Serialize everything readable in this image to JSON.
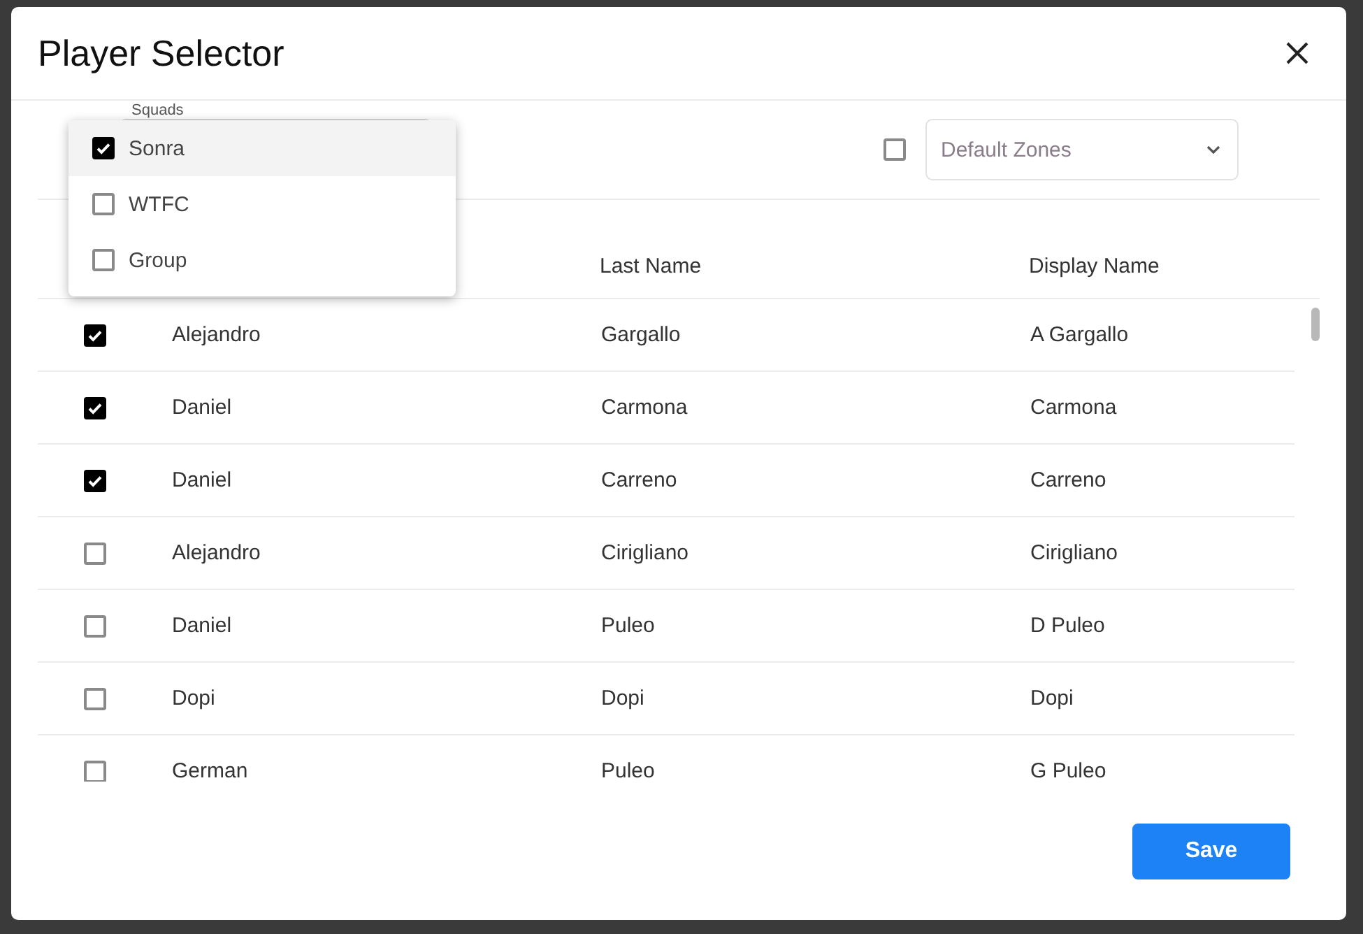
{
  "dialog": {
    "title": "Player Selector"
  },
  "squads": {
    "label": "Squads",
    "options": [
      {
        "label": "Sonra",
        "checked": true,
        "highlighted": true
      },
      {
        "label": "WTFC",
        "checked": false,
        "highlighted": false
      },
      {
        "label": "Group",
        "checked": false,
        "highlighted": false
      }
    ]
  },
  "zones": {
    "checked": false,
    "placeholder": "Default Zones"
  },
  "table": {
    "columns": [
      "Last Name",
      "Display Name"
    ],
    "rows": [
      {
        "checked": true,
        "first_name": "Alejandro",
        "last_name": "Gargallo",
        "display_name": "A Gargallo"
      },
      {
        "checked": true,
        "first_name": "Daniel",
        "last_name": "Carmona",
        "display_name": "Carmona"
      },
      {
        "checked": true,
        "first_name": "Daniel",
        "last_name": "Carreno",
        "display_name": "Carreno"
      },
      {
        "checked": false,
        "first_name": "Alejandro",
        "last_name": "Cirigliano",
        "display_name": "Cirigliano"
      },
      {
        "checked": false,
        "first_name": "Daniel",
        "last_name": "Puleo",
        "display_name": "D Puleo"
      },
      {
        "checked": false,
        "first_name": "Dopi",
        "last_name": "Dopi",
        "display_name": "Dopi"
      },
      {
        "checked": false,
        "first_name": "German",
        "last_name": "Puleo",
        "display_name": "G Puleo"
      }
    ]
  },
  "save_button": "Save"
}
